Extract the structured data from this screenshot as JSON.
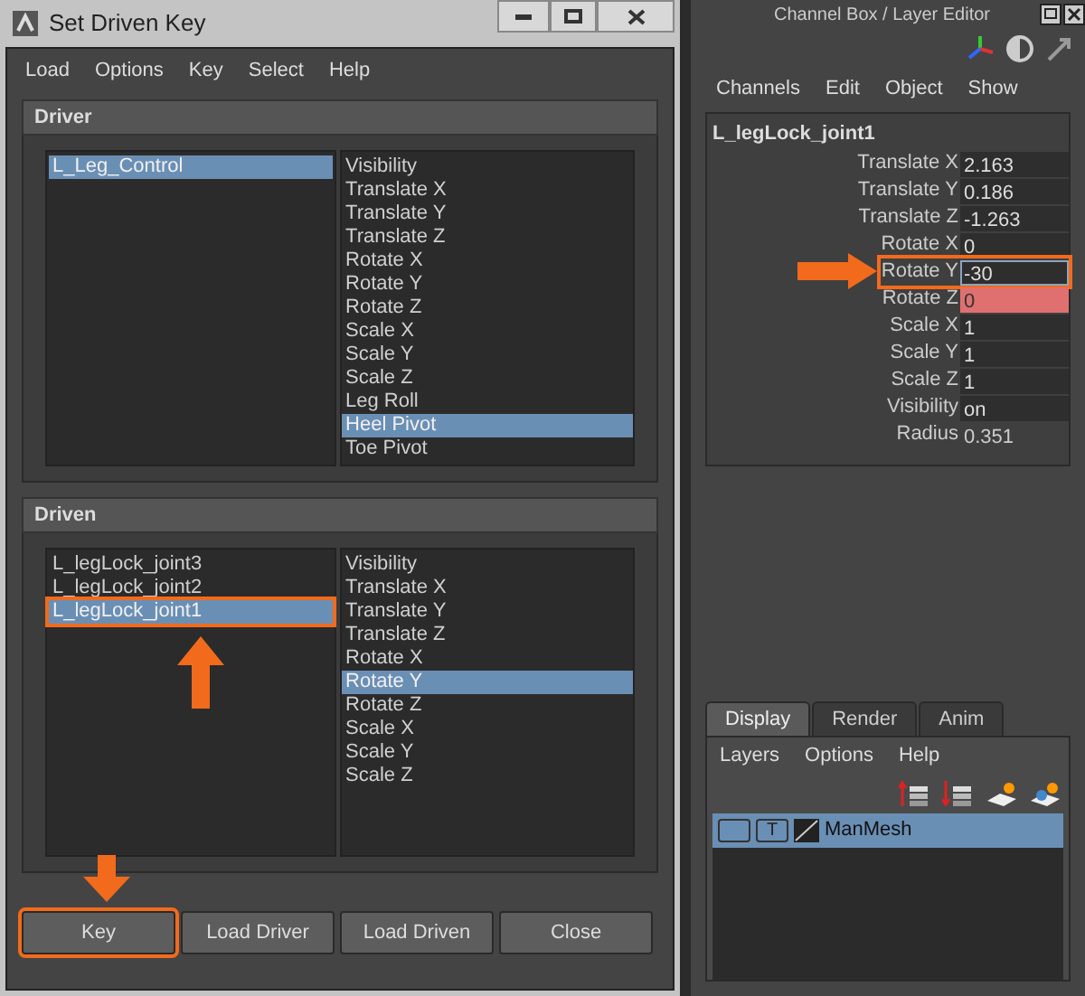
{
  "window": {
    "title": "Set Driven Key"
  },
  "menu": [
    "Load",
    "Options",
    "Key",
    "Select",
    "Help"
  ],
  "driver": {
    "title": "Driver",
    "objects": [
      {
        "label": "L_Leg_Control",
        "selected": true,
        "annotated": false
      }
    ],
    "attributes": [
      {
        "label": "Visibility",
        "selected": false
      },
      {
        "label": "Translate X",
        "selected": false
      },
      {
        "label": "Translate Y",
        "selected": false
      },
      {
        "label": "Translate Z",
        "selected": false
      },
      {
        "label": "Rotate X",
        "selected": false
      },
      {
        "label": "Rotate Y",
        "selected": false
      },
      {
        "label": "Rotate Z",
        "selected": false
      },
      {
        "label": "Scale X",
        "selected": false
      },
      {
        "label": "Scale Y",
        "selected": false
      },
      {
        "label": "Scale Z",
        "selected": false
      },
      {
        "label": "Leg Roll",
        "selected": false
      },
      {
        "label": "Heel Pivot",
        "selected": true
      },
      {
        "label": "Toe Pivot",
        "selected": false
      }
    ]
  },
  "driven": {
    "title": "Driven",
    "objects": [
      {
        "label": "L_legLock_joint3",
        "selected": false,
        "annotated": false
      },
      {
        "label": "L_legLock_joint2",
        "selected": false,
        "annotated": false
      },
      {
        "label": "L_legLock_joint1",
        "selected": true,
        "annotated": true,
        "pointed": true
      }
    ],
    "attributes": [
      {
        "label": "Visibility",
        "selected": false
      },
      {
        "label": "Translate X",
        "selected": false
      },
      {
        "label": "Translate Y",
        "selected": false
      },
      {
        "label": "Translate Z",
        "selected": false
      },
      {
        "label": "Rotate X",
        "selected": false
      },
      {
        "label": "Rotate Y",
        "selected": true
      },
      {
        "label": "Rotate Z",
        "selected": false
      },
      {
        "label": "Scale X",
        "selected": false
      },
      {
        "label": "Scale Y",
        "selected": false
      },
      {
        "label": "Scale Z",
        "selected": false
      }
    ]
  },
  "buttons": [
    {
      "label": "Key",
      "annotated": true,
      "pointed": true
    },
    {
      "label": "Load Driver",
      "annotated": false
    },
    {
      "label": "Load Driven",
      "annotated": false
    },
    {
      "label": "Close",
      "annotated": false
    }
  ],
  "channel_box": {
    "title": "Channel Box / Layer Editor",
    "menu": [
      "Channels",
      "Edit",
      "Object",
      "Show"
    ],
    "object": "L_legLock_joint1",
    "channels": [
      {
        "name": "Translate X",
        "value": "2.163",
        "kind": "field",
        "keyed": false,
        "editing": false,
        "annotated": false
      },
      {
        "name": "Translate Y",
        "value": "0.186",
        "kind": "field",
        "keyed": false,
        "editing": false,
        "annotated": false
      },
      {
        "name": "Translate Z",
        "value": "-1.263",
        "kind": "field",
        "keyed": false,
        "editing": false,
        "annotated": false
      },
      {
        "name": "Rotate X",
        "value": "0",
        "kind": "field",
        "keyed": false,
        "editing": false,
        "annotated": false
      },
      {
        "name": "Rotate Y",
        "value": "-30",
        "kind": "field",
        "keyed": false,
        "editing": true,
        "annotated": true,
        "pointed": true
      },
      {
        "name": "Rotate Z",
        "value": "0",
        "kind": "field",
        "keyed": true,
        "editing": false,
        "annotated": false
      },
      {
        "name": "Scale X",
        "value": "1",
        "kind": "field",
        "keyed": false,
        "editing": false,
        "annotated": false
      },
      {
        "name": "Scale Y",
        "value": "1",
        "kind": "field",
        "keyed": false,
        "editing": false,
        "annotated": false
      },
      {
        "name": "Scale Z",
        "value": "1",
        "kind": "field",
        "keyed": false,
        "editing": false,
        "annotated": false
      },
      {
        "name": "Visibility",
        "value": "on",
        "kind": "field",
        "keyed": false,
        "editing": false,
        "annotated": false
      },
      {
        "name": "Radius",
        "value": "0.351",
        "kind": "plain",
        "keyed": false,
        "editing": false,
        "annotated": false
      }
    ]
  },
  "layer_editor": {
    "tabs": [
      {
        "label": "Display",
        "selected": true
      },
      {
        "label": "Render",
        "selected": false
      },
      {
        "label": "Anim",
        "selected": false
      }
    ],
    "menu": [
      "Layers",
      "Options",
      "Help"
    ],
    "layers": [
      {
        "name": "ManMesh",
        "type_label": "T",
        "selected": true
      }
    ]
  }
}
